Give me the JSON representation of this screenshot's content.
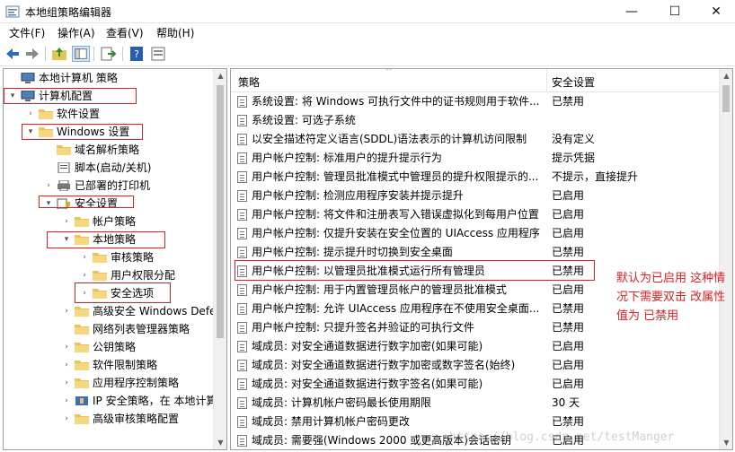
{
  "window": {
    "title": "本地组策略编辑器",
    "minimize": "—",
    "maximize": "☐",
    "close": "✕"
  },
  "menu": [
    "文件(F)",
    "操作(A)",
    "查看(V)",
    "帮助(H)"
  ],
  "toolbar": [
    "back-icon",
    "forward-icon",
    "up-folder-icon",
    "show-tree-icon",
    "export-icon",
    "help-icon",
    "properties-icon"
  ],
  "tree": [
    {
      "label": "本地计算机 策略",
      "icon": "computer-icon",
      "expander": ""
    },
    {
      "label": "计算机配置",
      "icon": "computer-icon",
      "expander": "▾"
    },
    {
      "label": "软件设置",
      "icon": "folder-icon",
      "expander": "›"
    },
    {
      "label": "Windows 设置",
      "icon": "folder-icon",
      "expander": "▾"
    },
    {
      "label": "域名解析策略",
      "icon": "folder-icon",
      "expander": ""
    },
    {
      "label": "脚本(启动/关机)",
      "icon": "script-icon",
      "expander": ""
    },
    {
      "label": "已部署的打印机",
      "icon": "printer-icon",
      "expander": "›"
    },
    {
      "label": "安全设置",
      "icon": "security-icon",
      "expander": "▾"
    },
    {
      "label": "帐户策略",
      "icon": "folder-icon",
      "expander": "›"
    },
    {
      "label": "本地策略",
      "icon": "folder-icon",
      "expander": "▾"
    },
    {
      "label": "审核策略",
      "icon": "folder-icon",
      "expander": "›"
    },
    {
      "label": "用户权限分配",
      "icon": "folder-icon",
      "expander": "›"
    },
    {
      "label": "安全选项",
      "icon": "folder-icon",
      "expander": "›"
    },
    {
      "label": "高级安全 Windows Defe",
      "icon": "folder-icon",
      "expander": "›"
    },
    {
      "label": "网络列表管理器策略",
      "icon": "folder-icon",
      "expander": ""
    },
    {
      "label": "公钥策略",
      "icon": "folder-icon",
      "expander": "›"
    },
    {
      "label": "软件限制策略",
      "icon": "folder-icon",
      "expander": "›"
    },
    {
      "label": "应用程序控制策略",
      "icon": "folder-icon",
      "expander": "›"
    },
    {
      "label": "IP 安全策略，在 本地计算",
      "icon": "ipsec-icon",
      "expander": "›"
    },
    {
      "label": "高级审核策略配置",
      "icon": "folder-icon",
      "expander": "›"
    }
  ],
  "list": {
    "col_policy": "策略",
    "col_setting": "安全设置",
    "rows": [
      {
        "name": "系统设置: 将 Windows 可执行文件中的证书规则用于软件...",
        "setting": "已禁用"
      },
      {
        "name": "系统设置: 可选子系统",
        "setting": ""
      },
      {
        "name": "以安全描述符定义语言(SDDL)语法表示的计算机访问限制",
        "setting": "没有定义"
      },
      {
        "name": "用户帐户控制: 标准用户的提升提示行为",
        "setting": "提示凭据"
      },
      {
        "name": "用户帐户控制: 管理员批准模式中管理员的提升权限提示的...",
        "setting": "不提示，直接提升"
      },
      {
        "name": "用户帐户控制: 检测应用程序安装并提示提升",
        "setting": "已启用"
      },
      {
        "name": "用户帐户控制: 将文件和注册表写入错误虚拟化到每用户位置",
        "setting": "已启用"
      },
      {
        "name": "用户帐户控制: 仅提升安装在安全位置的 UIAccess 应用程序",
        "setting": "已启用"
      },
      {
        "name": "用户帐户控制: 提示提升时切换到安全桌面",
        "setting": "已禁用"
      },
      {
        "name": "用户帐户控制: 以管理员批准模式运行所有管理员",
        "setting": "已禁用"
      },
      {
        "name": "用户帐户控制: 用于内置管理员帐户的管理员批准模式",
        "setting": "已启用"
      },
      {
        "name": "用户帐户控制: 允许 UIAccess 应用程序在不使用安全桌面...",
        "setting": "已禁用"
      },
      {
        "name": "用户帐户控制: 只提升签名并验证的可执行文件",
        "setting": "已禁用"
      },
      {
        "name": "域成员: 对安全通道数据进行数字加密(如果可能)",
        "setting": "已启用"
      },
      {
        "name": "域成员: 对安全通道数据进行数字加密或数字签名(始终)",
        "setting": "已启用"
      },
      {
        "name": "域成员: 对安全通道数据进行数字签名(如果可能)",
        "setting": "已启用"
      },
      {
        "name": "域成员: 计算机帐户密码最长使用期限",
        "setting": "30 天"
      },
      {
        "name": "域成员: 禁用计算机帐户密码更改",
        "setting": "已禁用"
      },
      {
        "name": "域成员: 需要强(Windows 2000 或更高版本)会话密钥",
        "setting": "已启用"
      }
    ]
  },
  "annotation": "默认为已启用 这种情况下需要双击 改属性值为 已禁用",
  "watermark": "https://blog.csdn.net/testManger",
  "colors": {
    "highlight_box": "#e02020",
    "folder": "#e8c35a"
  }
}
